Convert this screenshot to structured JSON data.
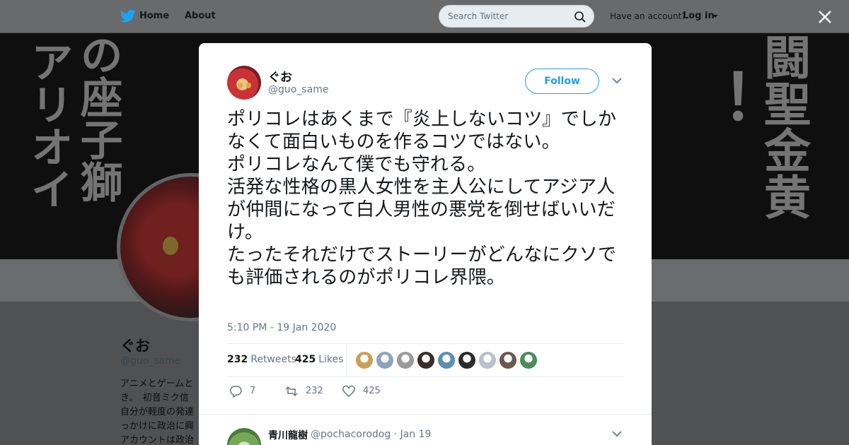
{
  "nav": {
    "home_label": "Home",
    "about_label": "About",
    "search_placeholder": "Search Twitter",
    "have_account": "Have an account?",
    "login_label": "Log in",
    "brand_color": "#1da1f2"
  },
  "profile": {
    "name": "ぐお",
    "handle": "@guo_same",
    "bio_lines": [
      "アニメとゲームと",
      "き。　初音ミク信",
      "自分が軽度の発達",
      "っかけに政治に興",
      "アカウントは政治"
    ]
  },
  "tweet": {
    "author_name": "ぐお",
    "author_handle": "@guo_same",
    "follow_label": "Follow",
    "text": "ポリコレはあくまで『炎上しないコツ』でしかなくて面白いものを作るコツではない。\nポリコレなんて僕でも守れる。\n活発な性格の黒人女性を主人公にしてアジア人が仲間になって白人男性の悪党を倒せばいいだけ。\nたったそれだけでストーリーがどんなにクソでも評価されるのがポリコレ界隈。",
    "timestamp": "5:10 PM - 19 Jan 2020",
    "retweets_count": "232",
    "retweets_label": "Retweets",
    "likes_count": "425",
    "likes_label": "Likes",
    "liker_colors": [
      "#c9a05a",
      "#8fa3b8",
      "#9a9a9a",
      "#3a2e28",
      "#5b8fb0",
      "#2b2b2b",
      "#b8c0c8",
      "#6b5a4e",
      "#4c8a5c"
    ],
    "actions": {
      "replies": "7",
      "retweets": "232",
      "likes": "425"
    }
  },
  "reply": {
    "name": "青川龍樹",
    "handle_meta": "@pochacorodog · Jan 19"
  }
}
